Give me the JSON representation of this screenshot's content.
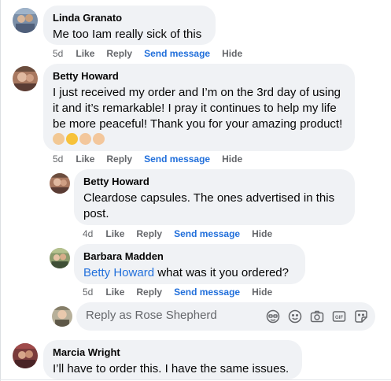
{
  "actions": {
    "like": "Like",
    "reply": "Reply",
    "send_message": "Send message",
    "hide": "Hide"
  },
  "comments": [
    {
      "author": "Linda Granato",
      "text": "Me too Iam really sick of this",
      "age": "5d"
    },
    {
      "author": "Betty Howard",
      "text": "I just received my order and I’m on the 3rd day of using it and it’s remarkable! I pray it continues to help my life be more peaceful! Thank you for your amazing product!",
      "age": "5d"
    },
    {
      "author": "Betty Howard",
      "text": "Cleardose capsules. The ones advertised in this post.",
      "age": "4d"
    },
    {
      "author": "Barbara Madden",
      "mention": "Betty Howard",
      "text": " what was it you ordered?",
      "age": "5d"
    },
    {
      "author": "Marcia Wright",
      "text": "I’ll have to order this. I have the same issues."
    }
  ],
  "reply_box": {
    "placeholder": "Reply as Rose Shepherd",
    "tools": [
      "avatar-sticker-icon",
      "emoji-icon",
      "camera-icon",
      "gif-icon",
      "sticker-icon"
    ]
  },
  "emoji_row": [
    "ok-hand-icon",
    "smiling-face-icon",
    "clapping-hands-icon",
    "clapping-hands-icon"
  ],
  "colors": {
    "bubble": "#f0f2f5",
    "link": "#216fdb",
    "meta": "#65676b",
    "text": "#050505"
  }
}
